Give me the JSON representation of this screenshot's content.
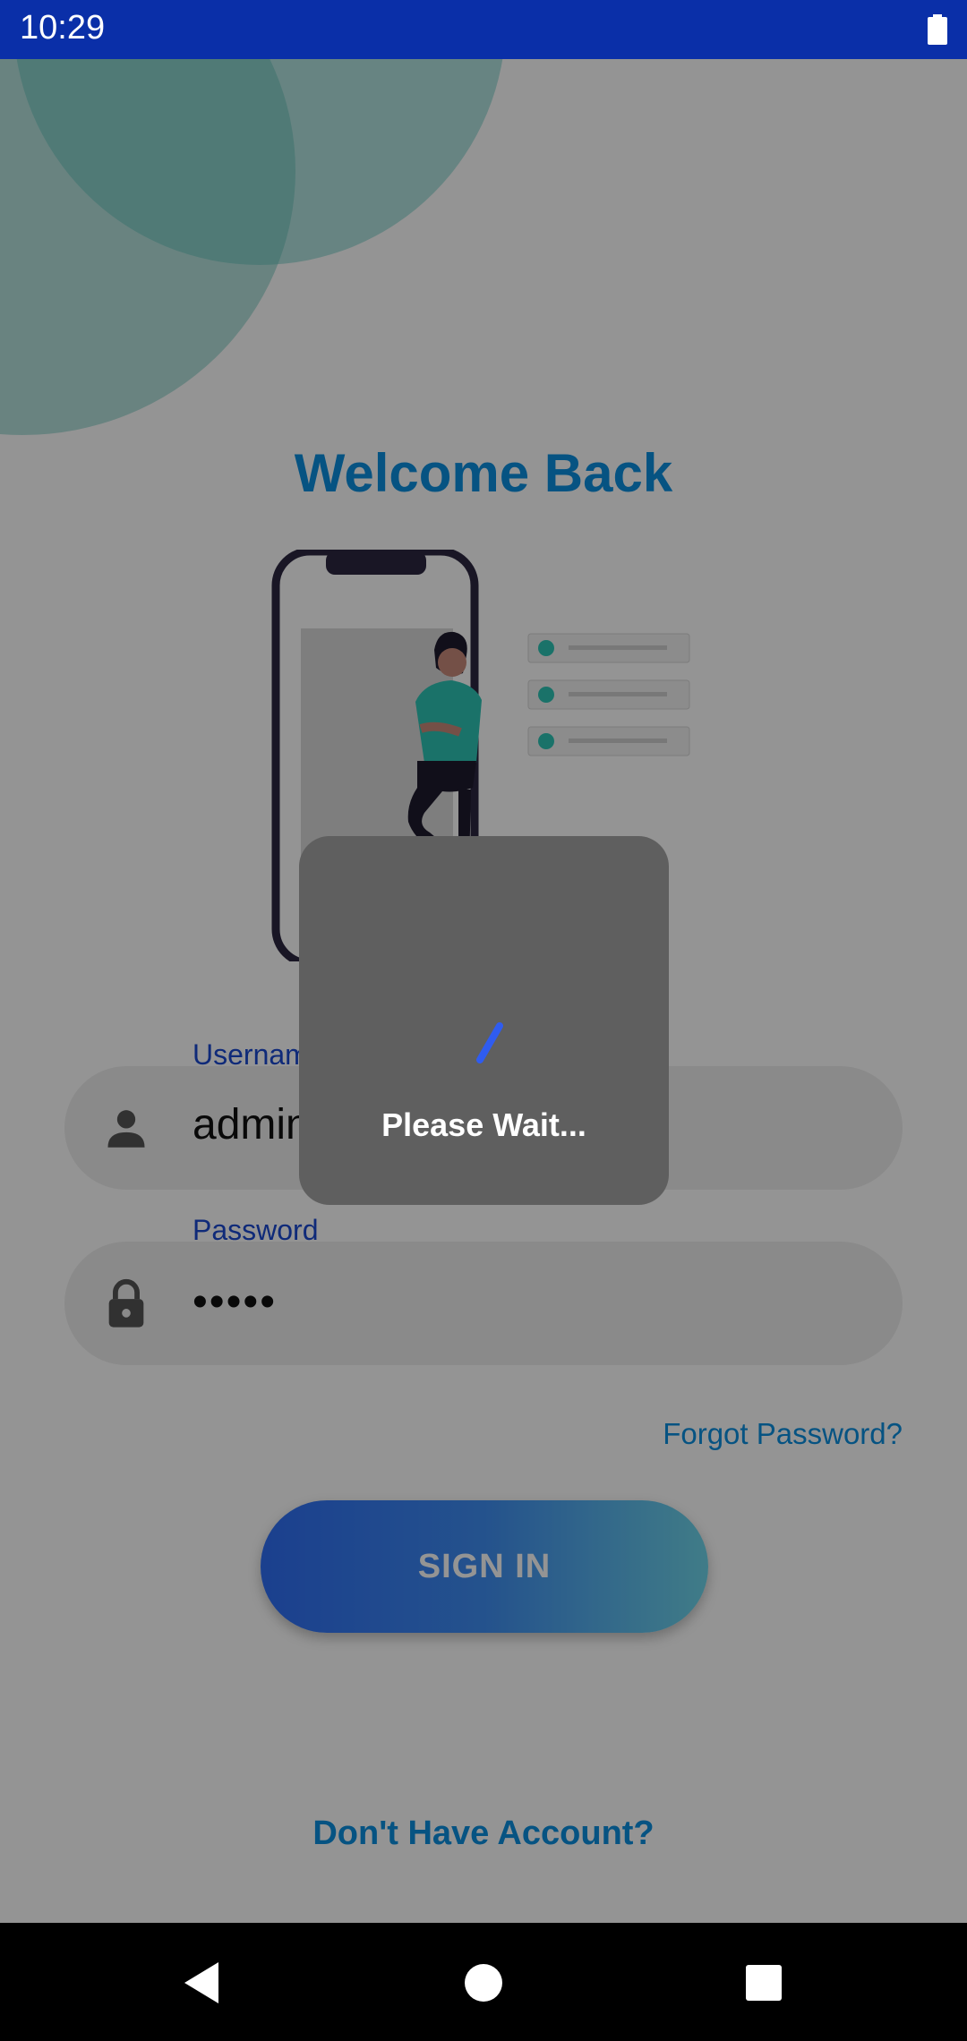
{
  "status_bar": {
    "time": "10:29",
    "battery_icon": "battery-full-icon"
  },
  "login": {
    "title": "Welcome Back",
    "username_label": "Username",
    "username_value": "admin",
    "username_icon": "person-icon",
    "password_label": "Password",
    "password_value": "•••••",
    "password_icon": "lock-icon",
    "forgot_password": "Forgot Password?",
    "signin_label": "SIGN IN",
    "signup_link": "Don't Have Account?"
  },
  "loading_dialog": {
    "message": "Please Wait...",
    "spinner_icon": "loading-spinner-icon"
  },
  "nav_bar": {
    "back_icon": "back-triangle-icon",
    "home_icon": "home-circle-icon",
    "recents_icon": "recents-square-icon"
  },
  "colors": {
    "status_bar": "#0a2fa8",
    "accent": "#0b8fe0",
    "label": "#1b49d0",
    "button_start": "#2f6ef5",
    "button_end": "#6fd6ea",
    "dialog": "#5f5f5f"
  }
}
